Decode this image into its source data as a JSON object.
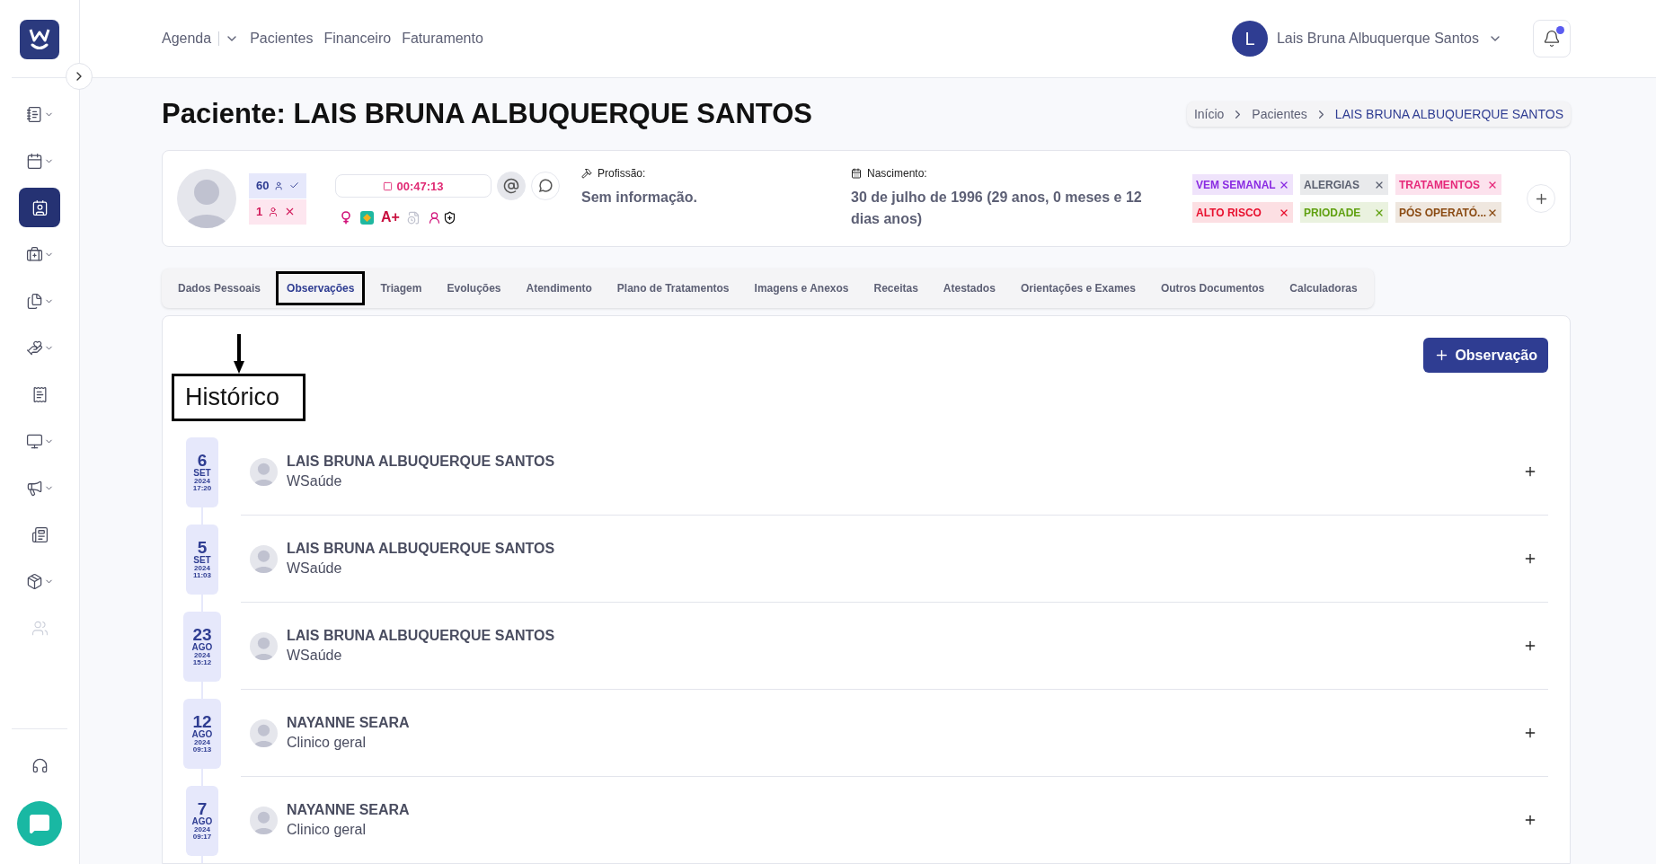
{
  "nav": {
    "items": [
      {
        "label": "Agenda",
        "dropdown": true
      },
      {
        "label": "Pacientes",
        "dropdown": false
      },
      {
        "label": "Financeiro",
        "dropdown": false
      },
      {
        "label": "Faturamento",
        "dropdown": false
      }
    ]
  },
  "user": {
    "initial": "L",
    "name": "Lais Bruna Albuquerque Santos",
    "has_notification": true
  },
  "sidebar": {
    "items": [
      {
        "expandable": true,
        "selected": false,
        "disabled": false
      },
      {
        "expandable": true,
        "selected": false,
        "disabled": false
      },
      {
        "expandable": false,
        "selected": true,
        "disabled": false
      },
      {
        "expandable": true,
        "selected": false,
        "disabled": false
      },
      {
        "expandable": true,
        "selected": false,
        "disabled": false
      },
      {
        "expandable": true,
        "selected": false,
        "disabled": false
      },
      {
        "expandable": false,
        "selected": false,
        "disabled": false
      },
      {
        "expandable": true,
        "selected": false,
        "disabled": false
      },
      {
        "expandable": true,
        "selected": false,
        "disabled": false
      },
      {
        "expandable": false,
        "selected": false,
        "disabled": false
      },
      {
        "expandable": true,
        "selected": false,
        "disabled": false
      },
      {
        "expandable": false,
        "selected": false,
        "disabled": true
      }
    ]
  },
  "page": {
    "title": "Paciente: LAIS BRUNA ALBUQUERQUE SANTOS"
  },
  "breadcrumb": [
    {
      "label": "Início",
      "current": false
    },
    {
      "label": "Pacientes",
      "current": false
    },
    {
      "label": "LAIS BRUNA ALBUQUERQUE SANTOS",
      "current": true
    }
  ],
  "patient": {
    "counters": [
      {
        "kind": "attended",
        "value": "60"
      },
      {
        "kind": "missed",
        "value": "1"
      }
    ],
    "timer": "00:47:13",
    "blood_type": "A+",
    "profession": {
      "label": "Profissão:",
      "value": "Sem informação."
    },
    "birth": {
      "label": "Nascimento:",
      "value": "30 de julho de 1996 (29 anos, 0 meses e 12 dias anos)"
    },
    "tags": [
      {
        "label": "VEM SEMANAL",
        "color": "#8a2be2"
      },
      {
        "label": "ALERGIAS",
        "color": "#5b6070"
      },
      {
        "label": "TRATAMENTOS",
        "color": "#e6287a"
      },
      {
        "label": "ALTO RISCO",
        "color": "#e8102e"
      },
      {
        "label": "PRIODADE",
        "color": "#5fa010"
      },
      {
        "label": "PÓS OPERATÓ...",
        "color": "#8a4a12"
      }
    ]
  },
  "tabs": [
    {
      "label": "Dados Pessoais",
      "selected": false
    },
    {
      "label": "Observações",
      "selected": true
    },
    {
      "label": "Triagem",
      "selected": false
    },
    {
      "label": "Evoluções",
      "selected": false
    },
    {
      "label": "Atendimento",
      "selected": false
    },
    {
      "label": "Plano de Tratamentos",
      "selected": false
    },
    {
      "label": "Imagens e Anexos",
      "selected": false
    },
    {
      "label": "Receitas",
      "selected": false
    },
    {
      "label": "Atestados",
      "selected": false
    },
    {
      "label": "Orientações e Exames",
      "selected": false
    },
    {
      "label": "Outros Documentos",
      "selected": false
    },
    {
      "label": "Calculadoras",
      "selected": false
    }
  ],
  "add_button": "Observação",
  "history": {
    "title": "Histórico",
    "entries": [
      {
        "day": "6",
        "month": "SET",
        "year": "2024",
        "time": "17:20",
        "name": "LAIS BRUNA ALBUQUERQUE SANTOS",
        "role": "WSaúde"
      },
      {
        "day": "5",
        "month": "SET",
        "year": "2024",
        "time": "11:03",
        "name": "LAIS BRUNA ALBUQUERQUE SANTOS",
        "role": "WSaúde"
      },
      {
        "day": "23",
        "month": "AGO",
        "year": "2024",
        "time": "15:12",
        "name": "LAIS BRUNA ALBUQUERQUE SANTOS",
        "role": "WSaúde"
      },
      {
        "day": "12",
        "month": "AGO",
        "year": "2024",
        "time": "09:13",
        "name": "NAYANNE SEARA",
        "role": "Clinico geral"
      },
      {
        "day": "7",
        "month": "AGO",
        "year": "2024",
        "time": "09:17",
        "name": "NAYANNE SEARA",
        "role": "Clinico geral"
      }
    ]
  }
}
